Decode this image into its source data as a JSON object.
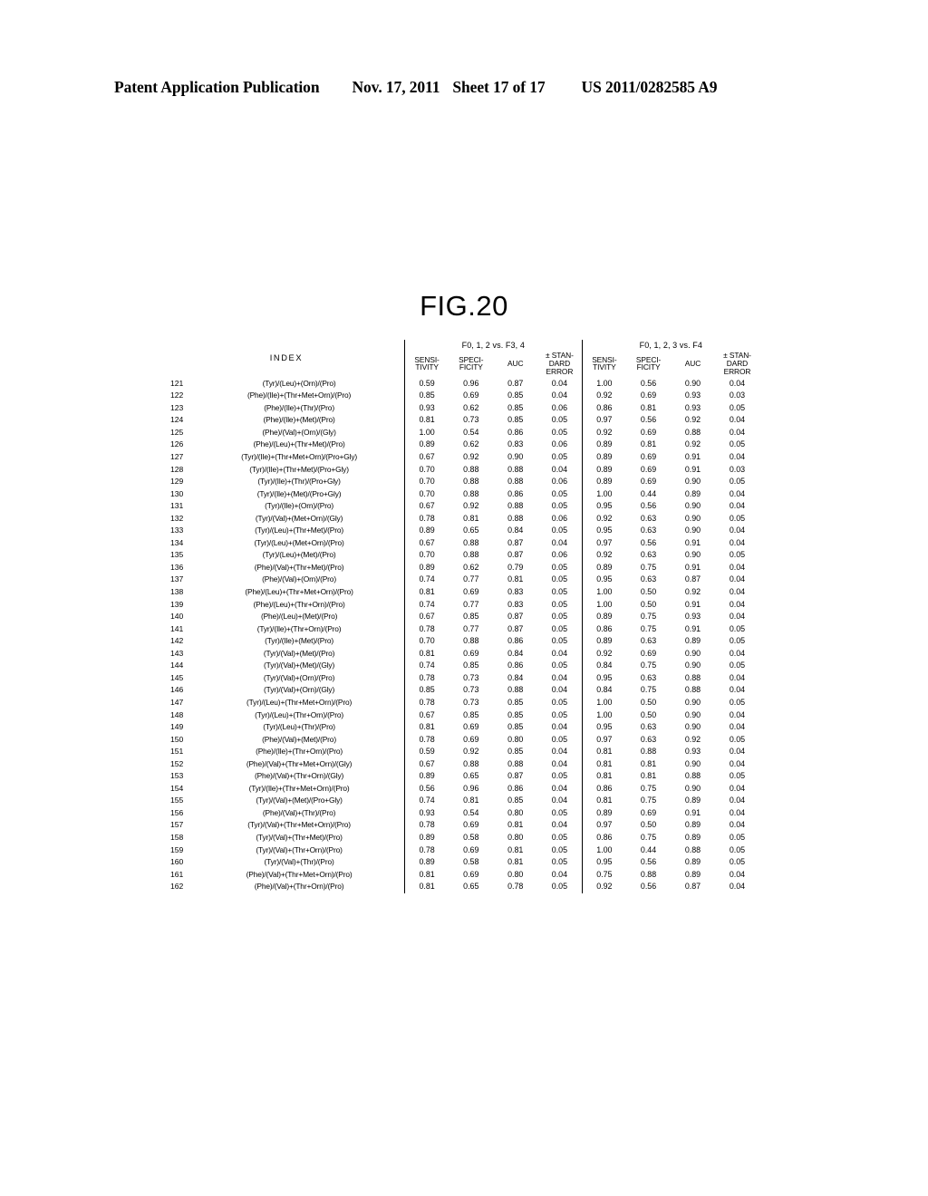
{
  "page_header": {
    "publication": "Patent Application Publication",
    "date": "Nov. 17, 2011",
    "sheet": "Sheet 17 of 17",
    "doc_number": "US 2011/0282585 A9"
  },
  "figure": {
    "title": "FIG.20"
  },
  "table": {
    "index_header": "INDEX",
    "group_headers": [
      "F0, 1, 2 vs. F3, 4",
      "F0, 1, 2, 3 vs. F4"
    ],
    "sub_headers": [
      [
        "SENSI-",
        "TIVITY"
      ],
      [
        "SPECI-",
        "FICITY"
      ],
      [
        "AUC"
      ],
      [
        "± STAN-",
        "DARD",
        "ERROR"
      ]
    ],
    "rows": [
      {
        "no": "121",
        "index": "(Tyr)/(Leu)+(Orn)/(Pro)",
        "g1": [
          "0.59",
          "0.96",
          "0.87",
          "0.04"
        ],
        "g2": [
          "1.00",
          "0.56",
          "0.90",
          "0.04"
        ]
      },
      {
        "no": "122",
        "index": "(Phe)/(Ile)+(Thr+Met+Orn)/(Pro)",
        "g1": [
          "0.85",
          "0.69",
          "0.85",
          "0.04"
        ],
        "g2": [
          "0.92",
          "0.69",
          "0.93",
          "0.03"
        ]
      },
      {
        "no": "123",
        "index": "(Phe)/(Ile)+(Thr)/(Pro)",
        "g1": [
          "0.93",
          "0.62",
          "0.85",
          "0.06"
        ],
        "g2": [
          "0.86",
          "0.81",
          "0.93",
          "0.05"
        ]
      },
      {
        "no": "124",
        "index": "(Phe)/(Ile)+(Met)/(Pro)",
        "g1": [
          "0.81",
          "0.73",
          "0.85",
          "0.05"
        ],
        "g2": [
          "0.97",
          "0.56",
          "0.92",
          "0.04"
        ]
      },
      {
        "no": "125",
        "index": "(Phe)/(Val)+(Orn)/(Gly)",
        "g1": [
          "1.00",
          "0.54",
          "0.86",
          "0.05"
        ],
        "g2": [
          "0.92",
          "0.69",
          "0.88",
          "0.04"
        ]
      },
      {
        "no": "126",
        "index": "(Phe)/(Leu)+(Thr+Met)/(Pro)",
        "g1": [
          "0.89",
          "0.62",
          "0.83",
          "0.06"
        ],
        "g2": [
          "0.89",
          "0.81",
          "0.92",
          "0.05"
        ]
      },
      {
        "no": "127",
        "index": "(Tyr)/(Ile)+(Thr+Met+Orn)/(Pro+Gly)",
        "g1": [
          "0.67",
          "0.92",
          "0.90",
          "0.05"
        ],
        "g2": [
          "0.89",
          "0.69",
          "0.91",
          "0.04"
        ]
      },
      {
        "no": "128",
        "index": "(Tyr)/(Ile)+(Thr+Met)/(Pro+Gly)",
        "g1": [
          "0.70",
          "0.88",
          "0.88",
          "0.04"
        ],
        "g2": [
          "0.89",
          "0.69",
          "0.91",
          "0.03"
        ]
      },
      {
        "no": "129",
        "index": "(Tyr)/(Ile)+(Thr)/(Pro+Gly)",
        "g1": [
          "0.70",
          "0.88",
          "0.88",
          "0.06"
        ],
        "g2": [
          "0.89",
          "0.69",
          "0.90",
          "0.05"
        ]
      },
      {
        "no": "130",
        "index": "(Tyr)/(Ile)+(Met)/(Pro+Gly)",
        "g1": [
          "0.70",
          "0.88",
          "0.86",
          "0.05"
        ],
        "g2": [
          "1.00",
          "0.44",
          "0.89",
          "0.04"
        ]
      },
      {
        "no": "131",
        "index": "(Tyr)/(Ile)+(Orn)/(Pro)",
        "g1": [
          "0.67",
          "0.92",
          "0.88",
          "0.05"
        ],
        "g2": [
          "0.95",
          "0.56",
          "0.90",
          "0.04"
        ]
      },
      {
        "no": "132",
        "index": "(Tyr)/(Val)+(Met+Orn)/(Gly)",
        "g1": [
          "0.78",
          "0.81",
          "0.88",
          "0.06"
        ],
        "g2": [
          "0.92",
          "0.63",
          "0.90",
          "0.05"
        ]
      },
      {
        "no": "133",
        "index": "(Tyr)/(Leu)+(Thr+Met)/(Pro)",
        "g1": [
          "0.89",
          "0.65",
          "0.84",
          "0.05"
        ],
        "g2": [
          "0.95",
          "0.63",
          "0.90",
          "0.04"
        ]
      },
      {
        "no": "134",
        "index": "(Tyr)/(Leu)+(Met+Orn)/(Pro)",
        "g1": [
          "0.67",
          "0.88",
          "0.87",
          "0.04"
        ],
        "g2": [
          "0.97",
          "0.56",
          "0.91",
          "0.04"
        ]
      },
      {
        "no": "135",
        "index": "(Tyr)/(Leu)+(Met)/(Pro)",
        "g1": [
          "0.70",
          "0.88",
          "0.87",
          "0.06"
        ],
        "g2": [
          "0.92",
          "0.63",
          "0.90",
          "0.05"
        ]
      },
      {
        "no": "136",
        "index": "(Phe)/(Val)+(Thr+Met)/(Pro)",
        "g1": [
          "0.89",
          "0.62",
          "0.79",
          "0.05"
        ],
        "g2": [
          "0.89",
          "0.75",
          "0.91",
          "0.04"
        ]
      },
      {
        "no": "137",
        "index": "(Phe)/(Val)+(Orn)/(Pro)",
        "g1": [
          "0.74",
          "0.77",
          "0.81",
          "0.05"
        ],
        "g2": [
          "0.95",
          "0.63",
          "0.87",
          "0.04"
        ]
      },
      {
        "no": "138",
        "index": "(Phe)/(Leu)+(Thr+Met+Orn)/(Pro)",
        "g1": [
          "0.81",
          "0.69",
          "0.83",
          "0.05"
        ],
        "g2": [
          "1.00",
          "0.50",
          "0.92",
          "0.04"
        ]
      },
      {
        "no": "139",
        "index": "(Phe)/(Leu)+(Thr+Orn)/(Pro)",
        "g1": [
          "0.74",
          "0.77",
          "0.83",
          "0.05"
        ],
        "g2": [
          "1.00",
          "0.50",
          "0.91",
          "0.04"
        ]
      },
      {
        "no": "140",
        "index": "(Phe)/(Leu)+(Met)/(Pro)",
        "g1": [
          "0.67",
          "0.85",
          "0.87",
          "0.05"
        ],
        "g2": [
          "0.89",
          "0.75",
          "0.93",
          "0.04"
        ]
      },
      {
        "no": "141",
        "index": "(Tyr)/(Ile)+(Thr+Orn)/(Pro)",
        "g1": [
          "0.78",
          "0.77",
          "0.87",
          "0.05"
        ],
        "g2": [
          "0.86",
          "0.75",
          "0.91",
          "0.05"
        ]
      },
      {
        "no": "142",
        "index": "(Tyr)/(Ile)+(Met)/(Pro)",
        "g1": [
          "0.70",
          "0.88",
          "0.86",
          "0.05"
        ],
        "g2": [
          "0.89",
          "0.63",
          "0.89",
          "0.05"
        ]
      },
      {
        "no": "143",
        "index": "(Tyr)/(Val)+(Met)/(Pro)",
        "g1": [
          "0.81",
          "0.69",
          "0.84",
          "0.04"
        ],
        "g2": [
          "0.92",
          "0.69",
          "0.90",
          "0.04"
        ]
      },
      {
        "no": "144",
        "index": "(Tyr)/(Val)+(Met)/(Gly)",
        "g1": [
          "0.74",
          "0.85",
          "0.86",
          "0.05"
        ],
        "g2": [
          "0.84",
          "0.75",
          "0.90",
          "0.05"
        ]
      },
      {
        "no": "145",
        "index": "(Tyr)/(Val)+(Orn)/(Pro)",
        "g1": [
          "0.78",
          "0.73",
          "0.84",
          "0.04"
        ],
        "g2": [
          "0.95",
          "0.63",
          "0.88",
          "0.04"
        ]
      },
      {
        "no": "146",
        "index": "(Tyr)/(Val)+(Orn)/(Gly)",
        "g1": [
          "0.85",
          "0.73",
          "0.88",
          "0.04"
        ],
        "g2": [
          "0.84",
          "0.75",
          "0.88",
          "0.04"
        ]
      },
      {
        "no": "147",
        "index": "(Tyr)/(Leu)+(Thr+Met+Orn)/(Pro)",
        "g1": [
          "0.78",
          "0.73",
          "0.85",
          "0.05"
        ],
        "g2": [
          "1.00",
          "0.50",
          "0.90",
          "0.05"
        ]
      },
      {
        "no": "148",
        "index": "(Tyr)/(Leu)+(Thr+Orn)/(Pro)",
        "g1": [
          "0.67",
          "0.85",
          "0.85",
          "0.05"
        ],
        "g2": [
          "1.00",
          "0.50",
          "0.90",
          "0.04"
        ]
      },
      {
        "no": "149",
        "index": "(Tyr)/(Leu)+(Thr)/(Pro)",
        "g1": [
          "0.81",
          "0.69",
          "0.85",
          "0.04"
        ],
        "g2": [
          "0.95",
          "0.63",
          "0.90",
          "0.04"
        ]
      },
      {
        "no": "150",
        "index": "(Phe)/(Val)+(Met)/(Pro)",
        "g1": [
          "0.78",
          "0.69",
          "0.80",
          "0.05"
        ],
        "g2": [
          "0.97",
          "0.63",
          "0.92",
          "0.05"
        ]
      },
      {
        "no": "151",
        "index": "(Phe)/(Ile)+(Thr+Orn)/(Pro)",
        "g1": [
          "0.59",
          "0.92",
          "0.85",
          "0.04"
        ],
        "g2": [
          "0.81",
          "0.88",
          "0.93",
          "0.04"
        ]
      },
      {
        "no": "152",
        "index": "(Phe)/(Val)+(Thr+Met+Orn)/(Gly)",
        "g1": [
          "0.67",
          "0.88",
          "0.88",
          "0.04"
        ],
        "g2": [
          "0.81",
          "0.81",
          "0.90",
          "0.04"
        ]
      },
      {
        "no": "153",
        "index": "(Phe)/(Val)+(Thr+Orn)/(Gly)",
        "g1": [
          "0.89",
          "0.65",
          "0.87",
          "0.05"
        ],
        "g2": [
          "0.81",
          "0.81",
          "0.88",
          "0.05"
        ]
      },
      {
        "no": "154",
        "index": "(Tyr)/(Ile)+(Thr+Met+Orn)/(Pro)",
        "g1": [
          "0.56",
          "0.96",
          "0.86",
          "0.04"
        ],
        "g2": [
          "0.86",
          "0.75",
          "0.90",
          "0.04"
        ]
      },
      {
        "no": "155",
        "index": "(Tyr)/(Val)+(Met)/(Pro+Gly)",
        "g1": [
          "0.74",
          "0.81",
          "0.85",
          "0.04"
        ],
        "g2": [
          "0.81",
          "0.75",
          "0.89",
          "0.04"
        ]
      },
      {
        "no": "156",
        "index": "(Phe)/(Val)+(Thr)/(Pro)",
        "g1": [
          "0.93",
          "0.54",
          "0.80",
          "0.05"
        ],
        "g2": [
          "0.89",
          "0.69",
          "0.91",
          "0.04"
        ]
      },
      {
        "no": "157",
        "index": "(Tyr)/(Val)+(Thr+Met+Orn)/(Pro)",
        "g1": [
          "0.78",
          "0.69",
          "0.81",
          "0.04"
        ],
        "g2": [
          "0.97",
          "0.50",
          "0.89",
          "0.04"
        ]
      },
      {
        "no": "158",
        "index": "(Tyr)/(Val)+(Thr+Met)/(Pro)",
        "g1": [
          "0.89",
          "0.58",
          "0.80",
          "0.05"
        ],
        "g2": [
          "0.86",
          "0.75",
          "0.89",
          "0.05"
        ]
      },
      {
        "no": "159",
        "index": "(Tyr)/(Val)+(Thr+Orn)/(Pro)",
        "g1": [
          "0.78",
          "0.69",
          "0.81",
          "0.05"
        ],
        "g2": [
          "1.00",
          "0.44",
          "0.88",
          "0.05"
        ]
      },
      {
        "no": "160",
        "index": "(Tyr)/(Val)+(Thr)/(Pro)",
        "g1": [
          "0.89",
          "0.58",
          "0.81",
          "0.05"
        ],
        "g2": [
          "0.95",
          "0.56",
          "0.89",
          "0.05"
        ]
      },
      {
        "no": "161",
        "index": "(Phe)/(Val)+(Thr+Met+Orn)/(Pro)",
        "g1": [
          "0.81",
          "0.69",
          "0.80",
          "0.04"
        ],
        "g2": [
          "0.75",
          "0.88",
          "0.89",
          "0.04"
        ]
      },
      {
        "no": "162",
        "index": "(Phe)/(Val)+(Thr+Orn)/(Pro)",
        "g1": [
          "0.81",
          "0.65",
          "0.78",
          "0.05"
        ],
        "g2": [
          "0.92",
          "0.56",
          "0.87",
          "0.04"
        ]
      }
    ]
  }
}
